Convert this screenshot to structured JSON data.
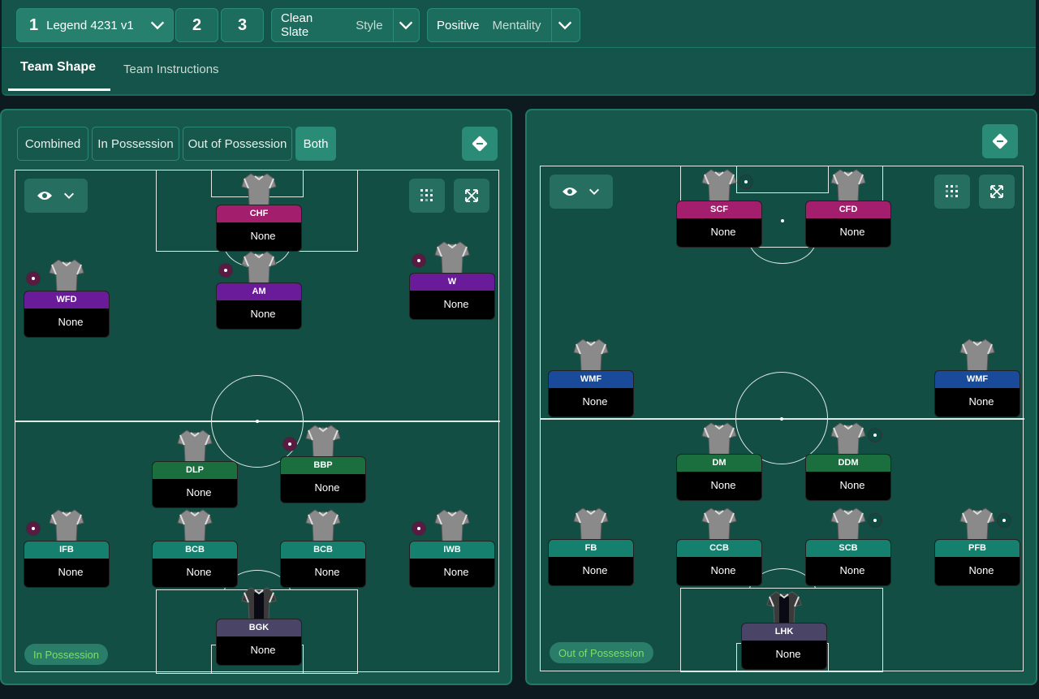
{
  "tactics": {
    "slots": [
      {
        "number": "1",
        "name": "Legend 4231 v1"
      },
      {
        "number": "2"
      },
      {
        "number": "3"
      }
    ]
  },
  "style": {
    "value": "Clean Slate",
    "label": "Style"
  },
  "mentality": {
    "value": "Positive",
    "label": "Mentality"
  },
  "tabs": {
    "team_shape": "Team Shape",
    "team_instructions": "Team Instructions"
  },
  "left_panel": {
    "segments": [
      "Combined",
      "In Possession",
      "Out of Possession",
      "Both"
    ],
    "active_segment": "Both",
    "phase_pill": "In Possession",
    "players": [
      {
        "role": "CHF",
        "name": "None",
        "color": "#a31e6c"
      },
      {
        "role": "WFD",
        "name": "None",
        "color": "#6a1b9a"
      },
      {
        "role": "AM",
        "name": "None",
        "color": "#6a1b9a"
      },
      {
        "role": "W",
        "name": "None",
        "color": "#6a1b9a"
      },
      {
        "role": "DLP",
        "name": "None",
        "color": "#1b6f3f"
      },
      {
        "role": "BBP",
        "name": "None",
        "color": "#1b6f3f"
      },
      {
        "role": "IFB",
        "name": "None",
        "color": "#15806e"
      },
      {
        "role": "BCB",
        "name": "None",
        "color": "#15806e"
      },
      {
        "role": "BCB",
        "name": "None",
        "color": "#15806e"
      },
      {
        "role": "IWB",
        "name": "None",
        "color": "#15806e"
      },
      {
        "role": "BGK",
        "name": "None",
        "color": "#4a4566"
      }
    ]
  },
  "right_panel": {
    "phase_pill": "Out of Possession",
    "players": [
      {
        "role": "SCF",
        "name": "None",
        "color": "#a31e6c"
      },
      {
        "role": "CFD",
        "name": "None",
        "color": "#a31e6c"
      },
      {
        "role": "WMF",
        "name": "None",
        "color": "#1a4a9a"
      },
      {
        "role": "WMF",
        "name": "None",
        "color": "#1a4a9a"
      },
      {
        "role": "DM",
        "name": "None",
        "color": "#1b6f3f"
      },
      {
        "role": "DDM",
        "name": "None",
        "color": "#1b6f3f"
      },
      {
        "role": "FB",
        "name": "None",
        "color": "#15806e"
      },
      {
        "role": "CCB",
        "name": "None",
        "color": "#15806e"
      },
      {
        "role": "SCB",
        "name": "None",
        "color": "#15806e"
      },
      {
        "role": "PFB",
        "name": "None",
        "color": "#15806e"
      },
      {
        "role": "LHK",
        "name": "None",
        "color": "#4a4566"
      }
    ]
  },
  "icons": {
    "chevron": "chevron-down-icon",
    "eye": "eye-icon",
    "grid": "grid-icon",
    "expand": "expand-icon",
    "swap": "swap-icon"
  },
  "colors": {
    "accent": "#2a8c77",
    "attack": "#a31e6c",
    "midfield_attack": "#6a1b9a",
    "wide_out": "#1a4a9a",
    "midfield": "#1b6f3f",
    "defence": "#15806e",
    "keeper": "#4a4566",
    "pill_text": "#7be06a"
  }
}
